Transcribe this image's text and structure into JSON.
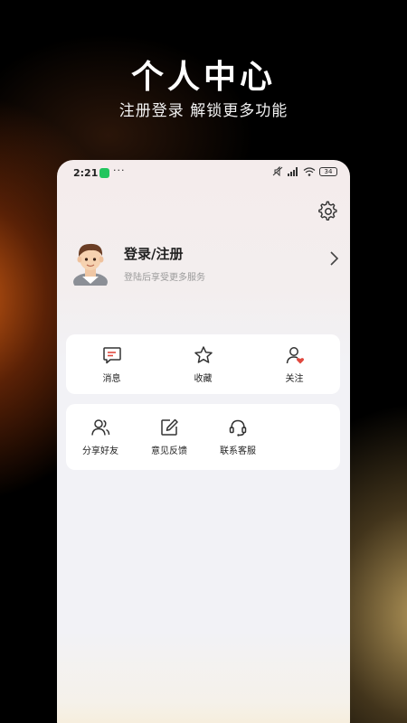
{
  "promo": {
    "title": "个人中心",
    "subtitle": "注册登录 解锁更多功能"
  },
  "statusbar": {
    "time": "2:21",
    "dots": "···",
    "battery": "34"
  },
  "profile": {
    "title": "登录/注册",
    "subtitle": "登陆后享受更多服务"
  },
  "quick_actions": [
    {
      "label": "消息",
      "icon": "message-icon"
    },
    {
      "label": "收藏",
      "icon": "star-icon"
    },
    {
      "label": "关注",
      "icon": "follow-user-icon"
    }
  ],
  "services": [
    {
      "label": "分享好友",
      "icon": "share-friends-icon"
    },
    {
      "label": "意见反馈",
      "icon": "feedback-edit-icon"
    },
    {
      "label": "联系客服",
      "icon": "headset-icon"
    }
  ],
  "colors": {
    "accent_red": "#e0483e",
    "status_green": "#22c55e"
  }
}
